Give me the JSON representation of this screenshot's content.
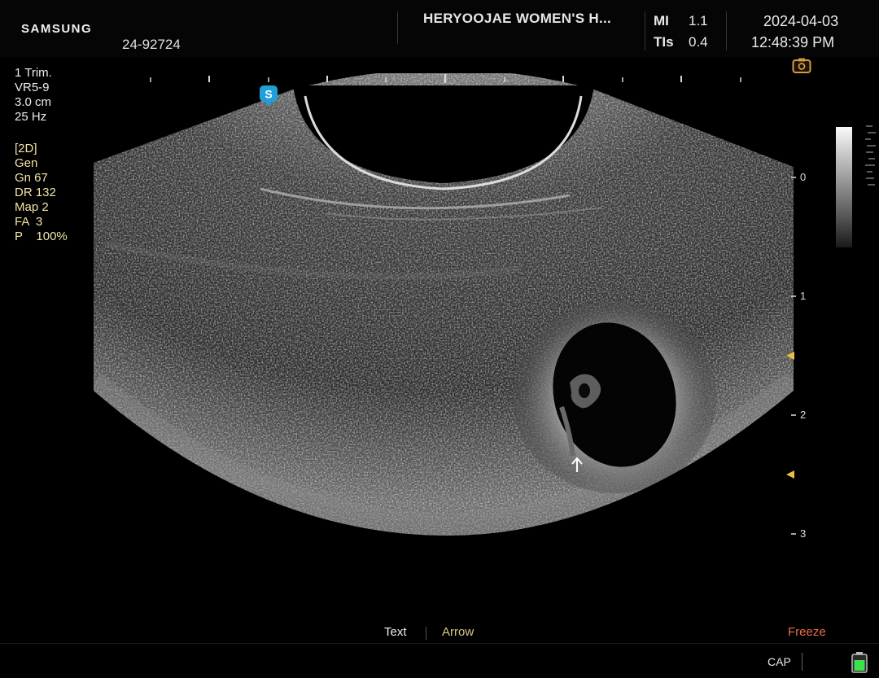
{
  "header": {
    "brand": "SAMSUNG",
    "patient_id": "24-92724",
    "institution": "HERYOOJAE WOMEN'S H...",
    "indices": [
      {
        "label": "MI",
        "value": "1.1"
      },
      {
        "label": "TIs",
        "value": "0.4"
      }
    ],
    "date": "2024-04-03",
    "time": "12:48:39 PM"
  },
  "parameters": {
    "probe": [
      "1 Trim.",
      "VR5-9",
      "3.0 cm",
      "25 Hz"
    ],
    "imaging": [
      "[2D]",
      "Gen",
      "Gn  67",
      "DR  132",
      "Map 2",
      "FA  3",
      "P    100%"
    ]
  },
  "image": {
    "orientation_marker": "S",
    "depth_labels": [
      "0",
      "1",
      "2",
      "3"
    ]
  },
  "footer": {
    "softkeys": {
      "text": "Text",
      "arrow": "Arrow",
      "freeze": "Freeze"
    },
    "cap": "CAP"
  },
  "colors": {
    "background": "#000000",
    "parameter_yellow": "#f0e3a8",
    "freeze_red": "#f06a4e",
    "arrow_gold": "#d6c78a",
    "marker_blue": "#1fa0d8",
    "focus_marker": "#e8c040",
    "battery_green": "#3ee04a"
  },
  "icons": [
    "orientation-marker-icon",
    "camera-icon",
    "focus-marker-icon",
    "annotation-arrow-icon",
    "battery-icon"
  ]
}
